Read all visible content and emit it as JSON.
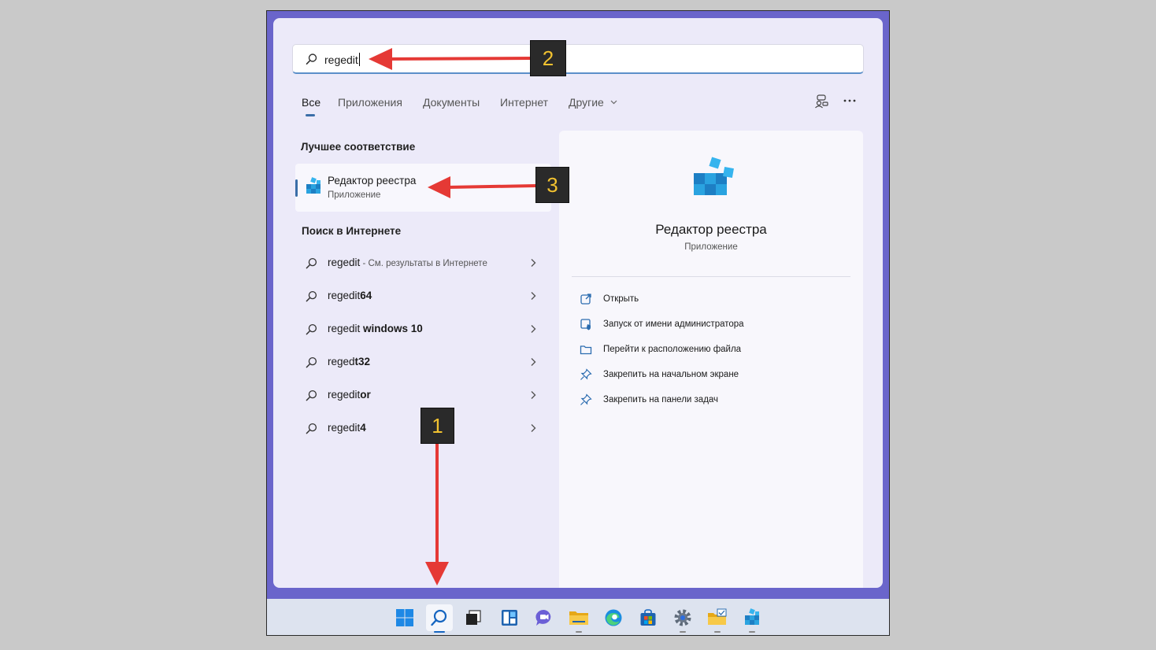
{
  "search": {
    "value": "regedit"
  },
  "tabs": [
    {
      "label": "Все",
      "active": true
    },
    {
      "label": "Приложения",
      "active": false
    },
    {
      "label": "Документы",
      "active": false
    },
    {
      "label": "Интернет",
      "active": false
    },
    {
      "label": "Другие",
      "active": false
    }
  ],
  "left": {
    "best_match_title": "Лучшее соответствие",
    "best_match": {
      "name": "Редактор реестра",
      "type": "Приложение"
    },
    "web_title": "Поиск в Интернете",
    "web_results": [
      {
        "prefix": "regedit",
        "bold": "",
        "hint": " - См. результаты в Интернете"
      },
      {
        "prefix": "regedit",
        "bold": "64",
        "hint": ""
      },
      {
        "prefix": "regedit",
        "bold": " windows 10",
        "hint": ""
      },
      {
        "prefix": "reged",
        "bold": "t32",
        "hint": ""
      },
      {
        "prefix": "regedit",
        "bold": "or",
        "hint": ""
      },
      {
        "prefix": "regedit",
        "bold": "4",
        "hint": ""
      }
    ]
  },
  "right": {
    "app_name": "Редактор реестра",
    "app_type": "Приложение",
    "actions": [
      {
        "label": "Открыть",
        "icon": "open-icon"
      },
      {
        "label": "Запуск от имени администратора",
        "icon": "admin-shield-icon"
      },
      {
        "label": "Перейти к расположению файла",
        "icon": "folder-icon"
      },
      {
        "label": "Закрепить на начальном экране",
        "icon": "pin-icon"
      },
      {
        "label": "Закрепить на панели задач",
        "icon": "pin-icon"
      }
    ]
  },
  "annotations": {
    "badge1": "1",
    "badge2": "2",
    "badge3": "3"
  },
  "taskbar": [
    "start-icon",
    "search-icon",
    "task-view-icon",
    "widgets-icon",
    "chat-icon",
    "file-explorer-icon",
    "edge-icon",
    "store-icon",
    "settings-icon",
    "explorer-folder-icon",
    "regedit-icon"
  ],
  "colors": {
    "frame": "#6a65cb",
    "accent": "#3a6ea8",
    "badge_text": "#f2c230",
    "arrow": "#e53935"
  }
}
